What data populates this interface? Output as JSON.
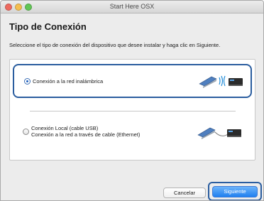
{
  "window": {
    "title": "Start Here OSX"
  },
  "page": {
    "title": "Tipo de Conexión",
    "instructions": "Seleccione el tipo de conexión del dispositivo que desee instalar y haga clic en Siguiente."
  },
  "options": [
    {
      "label": "Conexión a la red inalámbrica",
      "selected": true,
      "icon": "wireless-connection-icon"
    },
    {
      "label_line1": "Conexión Local (cable USB)",
      "label_line2": "Conexión a la red a través de cable (Ethernet)",
      "selected": false,
      "icon": "wired-connection-icon"
    }
  ],
  "buttons": {
    "cancel": "Cancelar",
    "next": "Siguiente"
  },
  "colors": {
    "highlight": "#2a5d9f",
    "primary_button": "#1f7ff0"
  }
}
